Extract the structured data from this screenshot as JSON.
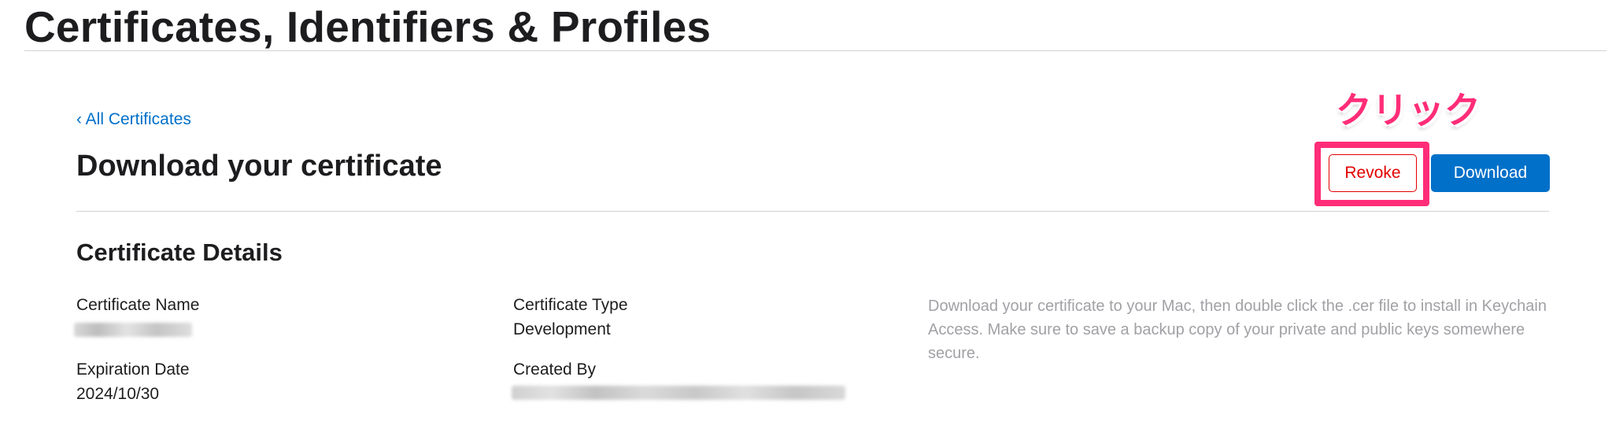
{
  "header": {
    "title": "Certificates, Identifiers & Profiles"
  },
  "nav": {
    "back_link": "‹ All Certificates"
  },
  "main": {
    "title": "Download your certificate",
    "actions": {
      "revoke_label": "Revoke",
      "download_label": "Download"
    },
    "annotation": "クリック",
    "annotation_color": "#ff2d78"
  },
  "details": {
    "heading": "Certificate Details",
    "certificate_name_label": "Certificate Name",
    "certificate_type_label": "Certificate Type",
    "certificate_type_value": "Development",
    "expiration_date_label": "Expiration Date",
    "expiration_date_value": "2024/10/30",
    "created_by_label": "Created By",
    "help_text": "Download your certificate to your Mac, then double click the .cer file to install in Keychain Access. Make sure to save a backup copy of your private and public keys somewhere secure."
  },
  "colors": {
    "accent": "#0070c9",
    "danger": "#e30000",
    "highlight": "#ff2d78"
  }
}
